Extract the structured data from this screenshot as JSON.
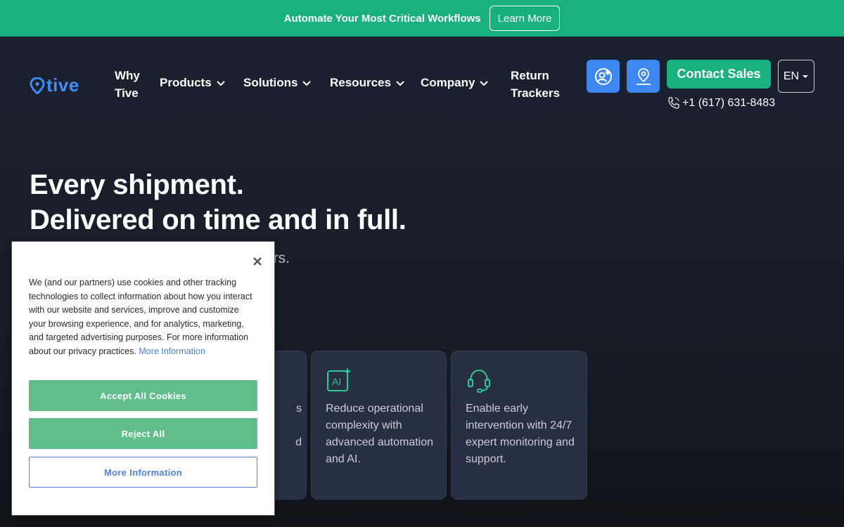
{
  "banner": {
    "text": "Automate Your Most Critical Workflows",
    "button_label": "Learn More"
  },
  "header": {
    "logo_text": "tive",
    "nav": {
      "why_line1": "Why",
      "why_line2": "Tive",
      "products": "Products",
      "solutions": "Solutions",
      "resources": "Resources",
      "company": "Company",
      "return_line1": "Return",
      "return_line2": "Trackers"
    },
    "contact_label": "Contact Sales",
    "phone": "+1 (617) 631-8483",
    "language": "EN"
  },
  "hero": {
    "title_line1": "Every shipment.",
    "title_line2": "Delivered on time and in full.",
    "subtitle_visible": "rs."
  },
  "cards": [
    {
      "icon": "partial-card-icon",
      "text_visible": "s\n\nd"
    },
    {
      "icon": "ai-sparkle-icon",
      "text": "Reduce operational complexity with advanced automation and AI."
    },
    {
      "icon": "headset-icon",
      "text": "Enable early intervention with 24/7 expert monitoring and support."
    }
  ],
  "cookie": {
    "policy_text": "We (and our partners) use cookies and other tracking technologies to collect information about how you interact with our website and services, improve and customize your browsing experience, and for analytics, marketing, and targeted advertising purposes. For more information about our privacy practices.",
    "more_info_link": "More Information",
    "accept_label": "Accept All Cookies",
    "reject_label": "Reject All",
    "more_info_label": "More Information"
  },
  "colors": {
    "brand_green": "#19b07f",
    "brand_blue": "#3e87f2",
    "background": "#1b2230",
    "cookie_button": "#5fbe8c",
    "link_blue": "#4f82d7"
  }
}
